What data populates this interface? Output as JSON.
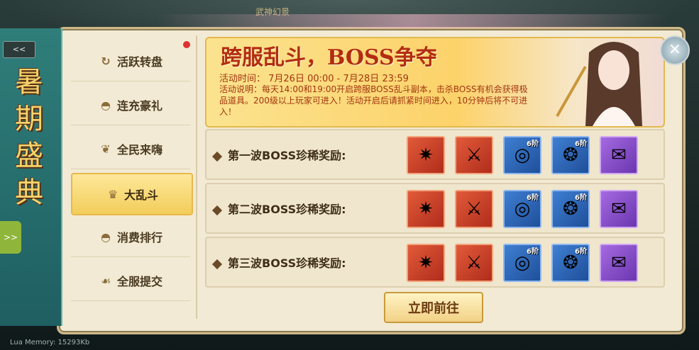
{
  "top_title": "武神幻景",
  "footer": "Lua Memory: 15293Kb",
  "banner": {
    "chars": [
      "暑",
      "期",
      "盛",
      "典"
    ],
    "collapse_label": "<<",
    "expand_label": ">>"
  },
  "sidebar": {
    "items": [
      {
        "label": "活跃转盘",
        "icon": "spin-icon"
      },
      {
        "label": "连充豪礼",
        "icon": "ingot-icon"
      },
      {
        "label": "全民来嗨",
        "icon": "lotus-icon"
      },
      {
        "label": "大乱斗",
        "icon": "crest-icon",
        "active": true
      },
      {
        "label": "消费排行",
        "icon": "ingot-icon"
      },
      {
        "label": "全服提交",
        "icon": "hand-icon"
      }
    ]
  },
  "event": {
    "title": "跨服乱斗，BOSS争夺",
    "time": "活动时间：  7月26日 00:00 - 7月28日 23:59",
    "desc": "活动说明：每天14:00和19:00开启跨服BOSS乱斗副本，击杀BOSS有机会获得极品道具。200级以上玩家可进入！活动开启后请抓紧时间进入，10分钟后将不可进入！"
  },
  "waves": [
    {
      "label": "第一波BOSS珍稀奖励:"
    },
    {
      "label": "第二波BOSS珍稀奖励:"
    },
    {
      "label": "第三波BOSS珍稀奖励:"
    }
  ],
  "items": [
    {
      "type": "red",
      "glyph": "✷",
      "tier": ""
    },
    {
      "type": "red",
      "glyph": "⚔",
      "tier": ""
    },
    {
      "type": "blue",
      "glyph": "◎",
      "tier": "6阶"
    },
    {
      "type": "blue",
      "glyph": "❂",
      "tier": "6阶"
    },
    {
      "type": "purple",
      "glyph": "✉",
      "tier": ""
    }
  ],
  "go_button": "立即前往",
  "close_icon": "×"
}
